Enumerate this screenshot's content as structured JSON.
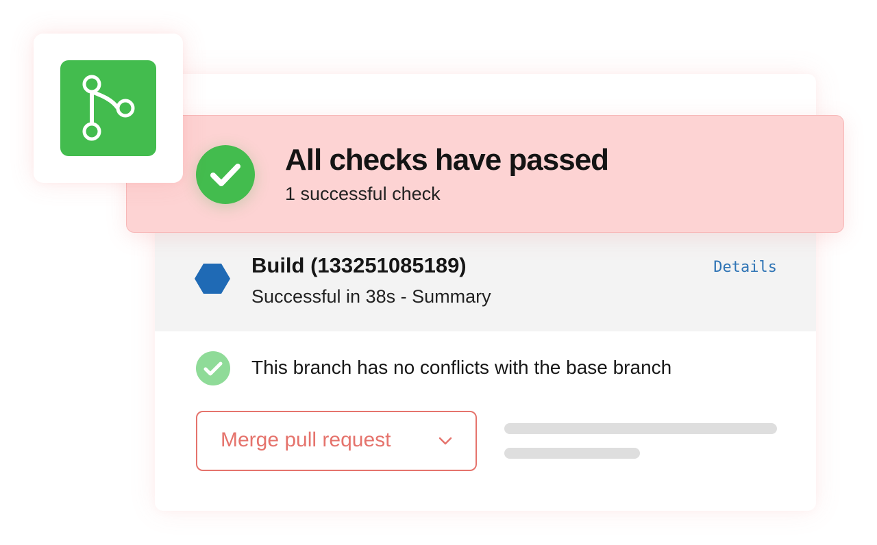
{
  "colors": {
    "brand_green": "#43bc4e",
    "check_green": "#43bc4e",
    "check_green_light": "#8fdb98",
    "banner_bg": "#fdd3d3",
    "build_icon_blue": "#1f6ab5",
    "details_blue": "#2f74b5",
    "merge_accent": "#e5736c",
    "skeleton_gray": "#dedede"
  },
  "logo": {
    "icon": "git-branch-icon"
  },
  "banner": {
    "icon": "check-circle-icon",
    "title": "All checks have passed",
    "subtitle": "1 successful check"
  },
  "build": {
    "icon": "hexagon-icon",
    "title": "Build (133251085189)",
    "subtitle": "Successful in 38s - Summary",
    "details_label": "Details"
  },
  "conflicts": {
    "icon": "check-circle-icon",
    "text": "This branch has no conflicts with the base branch"
  },
  "merge": {
    "label": "Merge pull request",
    "icon": "chevron-down-icon"
  }
}
